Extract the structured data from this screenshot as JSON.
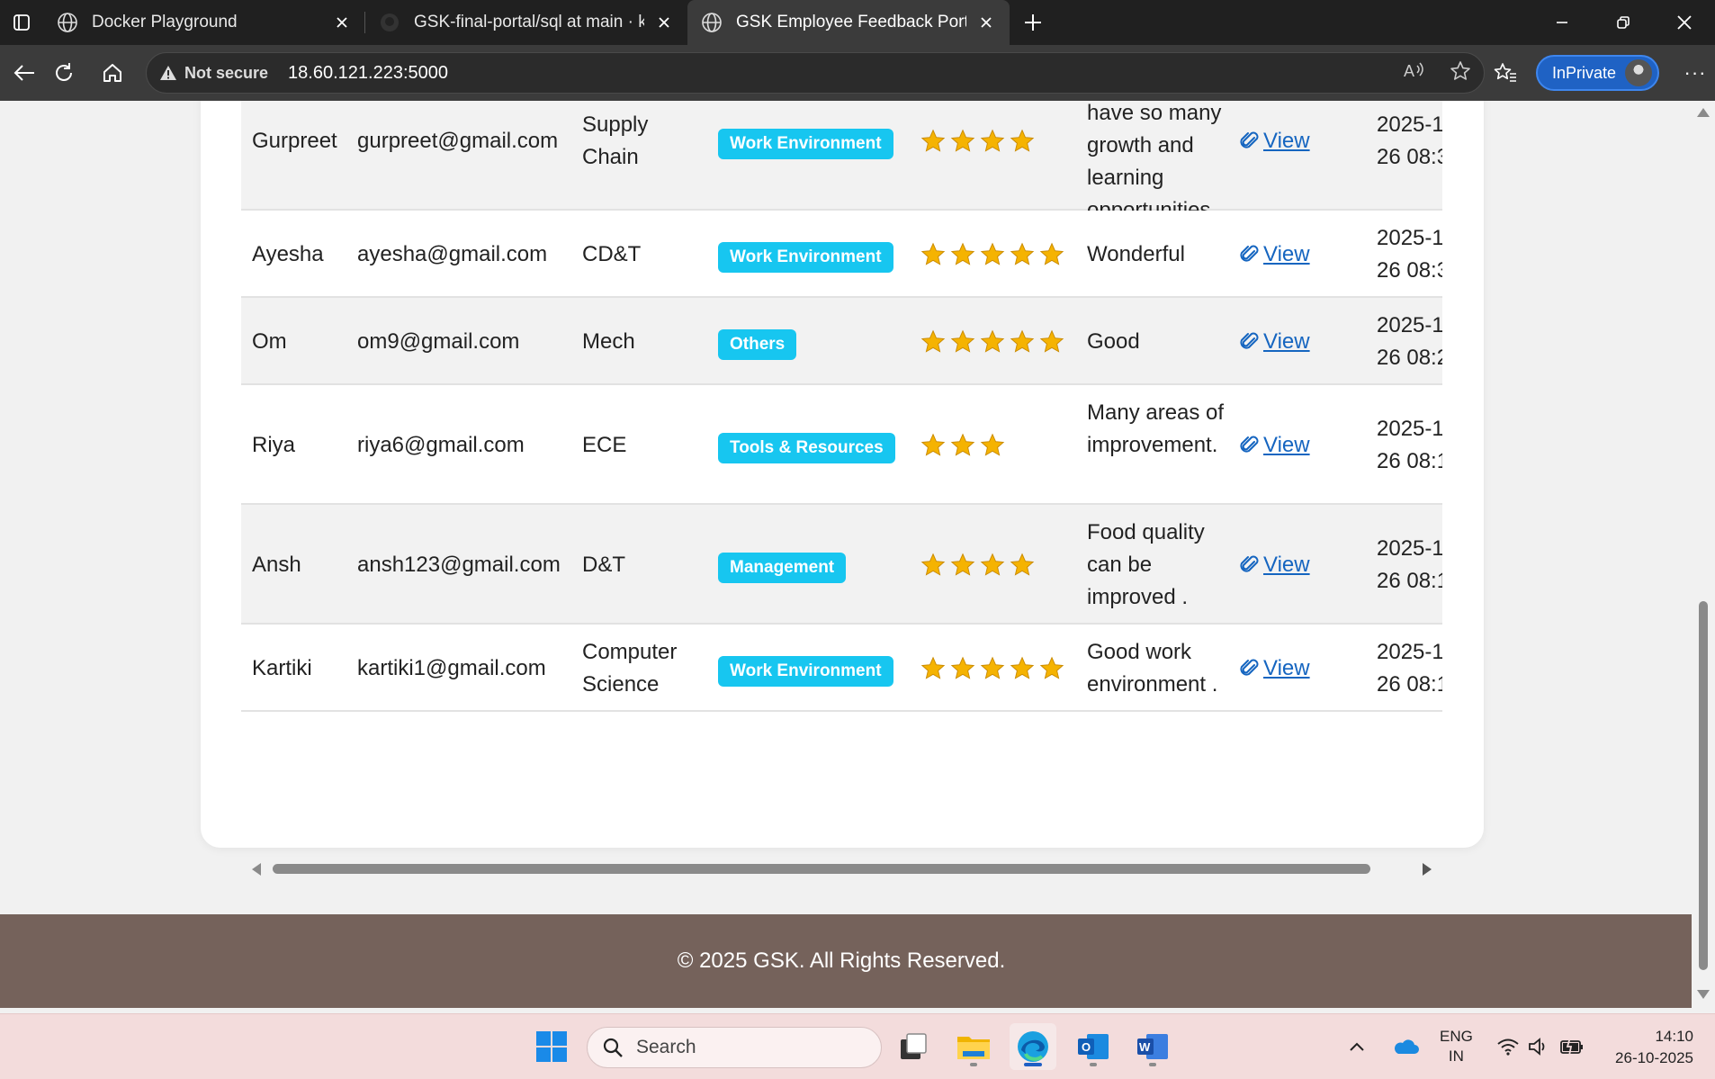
{
  "browser": {
    "tabs": [
      {
        "title": "Docker Playground",
        "icon": "globe-icon",
        "active": false
      },
      {
        "title": "GSK-final-portal/sql at main · kart",
        "icon": "github-icon",
        "active": false
      },
      {
        "title": "GSK Employee Feedback Portal",
        "icon": "globe-icon",
        "active": true
      }
    ],
    "security_label": "Not secure",
    "url": "18.60.121.223:5000",
    "inprivate_label": "InPrivate"
  },
  "feedback_rows": [
    {
      "name": "Gurpreet",
      "email": "gurpreet@gmail.com",
      "department": "Supply Chain",
      "category": "Work Environment",
      "rating": 4,
      "comment": "environment, have so many growth and learning opportunities",
      "attachment": "View",
      "date": "2025-1\n26 08:3"
    },
    {
      "name": "Ayesha",
      "email": "ayesha@gmail.com",
      "department": "CD&T",
      "category": "Work Environment",
      "rating": 5,
      "comment": "Wonderful",
      "attachment": "View",
      "date": "2025-1\n26 08:3"
    },
    {
      "name": "Om",
      "email": "om9@gmail.com",
      "department": "Mech",
      "category": "Others",
      "rating": 5,
      "comment": "Good",
      "attachment": "View",
      "date": "2025-1\n26 08:2"
    },
    {
      "name": "Riya",
      "email": "riya6@gmail.com",
      "department": "ECE",
      "category": "Tools & Resources",
      "rating": 3,
      "comment": "Many areas of improvement.",
      "attachment": "View",
      "date": "2025-1\n26 08:1"
    },
    {
      "name": "Ansh",
      "email": "ansh123@gmail.com",
      "department": "D&T",
      "category": "Management",
      "rating": 4,
      "comment": "Food quality can be improved .",
      "attachment": "View",
      "date": "2025-1\n26 08:1"
    },
    {
      "name": "Kartiki",
      "email": "kartiki1@gmail.com",
      "department": "Computer Science",
      "category": "Work Environment",
      "rating": 5,
      "comment": "Good work environment .",
      "attachment": "View",
      "date": "2025-1\n26 08:1"
    }
  ],
  "colors": {
    "badge": "#17c6f0",
    "footer": "#75625b",
    "link": "#1565c0",
    "star": "#f5b301"
  },
  "footer": {
    "text": "© 2025 GSK. All Rights Reserved."
  },
  "taskbar": {
    "search_placeholder": "Search",
    "apps": [
      "windows-start-icon",
      "task-view-icon",
      "file-explorer-icon",
      "edge-icon",
      "outlook-icon",
      "word-icon"
    ],
    "language_line1": "ENG",
    "language_line2": "IN",
    "time": "14:10",
    "date": "26-10-2025"
  }
}
